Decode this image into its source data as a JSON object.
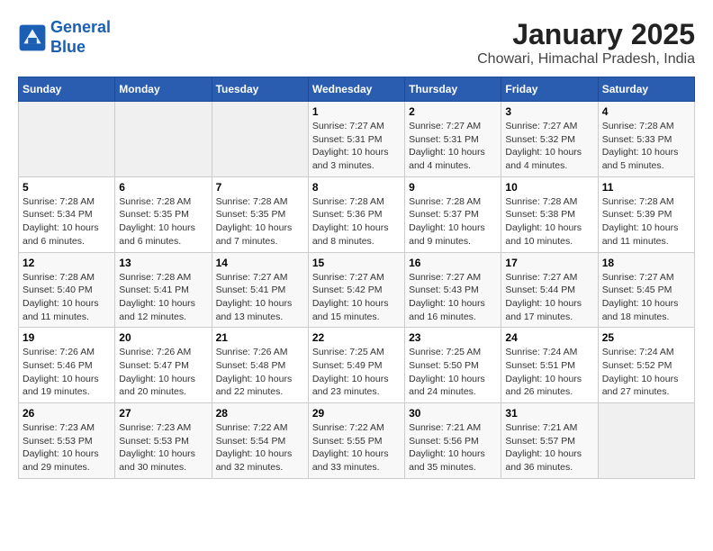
{
  "header": {
    "logo_line1": "General",
    "logo_line2": "Blue",
    "title": "January 2025",
    "subtitle": "Chowari, Himachal Pradesh, India"
  },
  "days_of_week": [
    "Sunday",
    "Monday",
    "Tuesday",
    "Wednesday",
    "Thursday",
    "Friday",
    "Saturday"
  ],
  "weeks": [
    [
      {
        "num": "",
        "info": ""
      },
      {
        "num": "",
        "info": ""
      },
      {
        "num": "",
        "info": ""
      },
      {
        "num": "1",
        "info": "Sunrise: 7:27 AM\nSunset: 5:31 PM\nDaylight: 10 hours\nand 3 minutes."
      },
      {
        "num": "2",
        "info": "Sunrise: 7:27 AM\nSunset: 5:31 PM\nDaylight: 10 hours\nand 4 minutes."
      },
      {
        "num": "3",
        "info": "Sunrise: 7:27 AM\nSunset: 5:32 PM\nDaylight: 10 hours\nand 4 minutes."
      },
      {
        "num": "4",
        "info": "Sunrise: 7:28 AM\nSunset: 5:33 PM\nDaylight: 10 hours\nand 5 minutes."
      }
    ],
    [
      {
        "num": "5",
        "info": "Sunrise: 7:28 AM\nSunset: 5:34 PM\nDaylight: 10 hours\nand 6 minutes."
      },
      {
        "num": "6",
        "info": "Sunrise: 7:28 AM\nSunset: 5:35 PM\nDaylight: 10 hours\nand 6 minutes."
      },
      {
        "num": "7",
        "info": "Sunrise: 7:28 AM\nSunset: 5:35 PM\nDaylight: 10 hours\nand 7 minutes."
      },
      {
        "num": "8",
        "info": "Sunrise: 7:28 AM\nSunset: 5:36 PM\nDaylight: 10 hours\nand 8 minutes."
      },
      {
        "num": "9",
        "info": "Sunrise: 7:28 AM\nSunset: 5:37 PM\nDaylight: 10 hours\nand 9 minutes."
      },
      {
        "num": "10",
        "info": "Sunrise: 7:28 AM\nSunset: 5:38 PM\nDaylight: 10 hours\nand 10 minutes."
      },
      {
        "num": "11",
        "info": "Sunrise: 7:28 AM\nSunset: 5:39 PM\nDaylight: 10 hours\nand 11 minutes."
      }
    ],
    [
      {
        "num": "12",
        "info": "Sunrise: 7:28 AM\nSunset: 5:40 PM\nDaylight: 10 hours\nand 11 minutes."
      },
      {
        "num": "13",
        "info": "Sunrise: 7:28 AM\nSunset: 5:41 PM\nDaylight: 10 hours\nand 12 minutes."
      },
      {
        "num": "14",
        "info": "Sunrise: 7:27 AM\nSunset: 5:41 PM\nDaylight: 10 hours\nand 13 minutes."
      },
      {
        "num": "15",
        "info": "Sunrise: 7:27 AM\nSunset: 5:42 PM\nDaylight: 10 hours\nand 15 minutes."
      },
      {
        "num": "16",
        "info": "Sunrise: 7:27 AM\nSunset: 5:43 PM\nDaylight: 10 hours\nand 16 minutes."
      },
      {
        "num": "17",
        "info": "Sunrise: 7:27 AM\nSunset: 5:44 PM\nDaylight: 10 hours\nand 17 minutes."
      },
      {
        "num": "18",
        "info": "Sunrise: 7:27 AM\nSunset: 5:45 PM\nDaylight: 10 hours\nand 18 minutes."
      }
    ],
    [
      {
        "num": "19",
        "info": "Sunrise: 7:26 AM\nSunset: 5:46 PM\nDaylight: 10 hours\nand 19 minutes."
      },
      {
        "num": "20",
        "info": "Sunrise: 7:26 AM\nSunset: 5:47 PM\nDaylight: 10 hours\nand 20 minutes."
      },
      {
        "num": "21",
        "info": "Sunrise: 7:26 AM\nSunset: 5:48 PM\nDaylight: 10 hours\nand 22 minutes."
      },
      {
        "num": "22",
        "info": "Sunrise: 7:25 AM\nSunset: 5:49 PM\nDaylight: 10 hours\nand 23 minutes."
      },
      {
        "num": "23",
        "info": "Sunrise: 7:25 AM\nSunset: 5:50 PM\nDaylight: 10 hours\nand 24 minutes."
      },
      {
        "num": "24",
        "info": "Sunrise: 7:24 AM\nSunset: 5:51 PM\nDaylight: 10 hours\nand 26 minutes."
      },
      {
        "num": "25",
        "info": "Sunrise: 7:24 AM\nSunset: 5:52 PM\nDaylight: 10 hours\nand 27 minutes."
      }
    ],
    [
      {
        "num": "26",
        "info": "Sunrise: 7:23 AM\nSunset: 5:53 PM\nDaylight: 10 hours\nand 29 minutes."
      },
      {
        "num": "27",
        "info": "Sunrise: 7:23 AM\nSunset: 5:53 PM\nDaylight: 10 hours\nand 30 minutes."
      },
      {
        "num": "28",
        "info": "Sunrise: 7:22 AM\nSunset: 5:54 PM\nDaylight: 10 hours\nand 32 minutes."
      },
      {
        "num": "29",
        "info": "Sunrise: 7:22 AM\nSunset: 5:55 PM\nDaylight: 10 hours\nand 33 minutes."
      },
      {
        "num": "30",
        "info": "Sunrise: 7:21 AM\nSunset: 5:56 PM\nDaylight: 10 hours\nand 35 minutes."
      },
      {
        "num": "31",
        "info": "Sunrise: 7:21 AM\nSunset: 5:57 PM\nDaylight: 10 hours\nand 36 minutes."
      },
      {
        "num": "",
        "info": ""
      }
    ]
  ]
}
